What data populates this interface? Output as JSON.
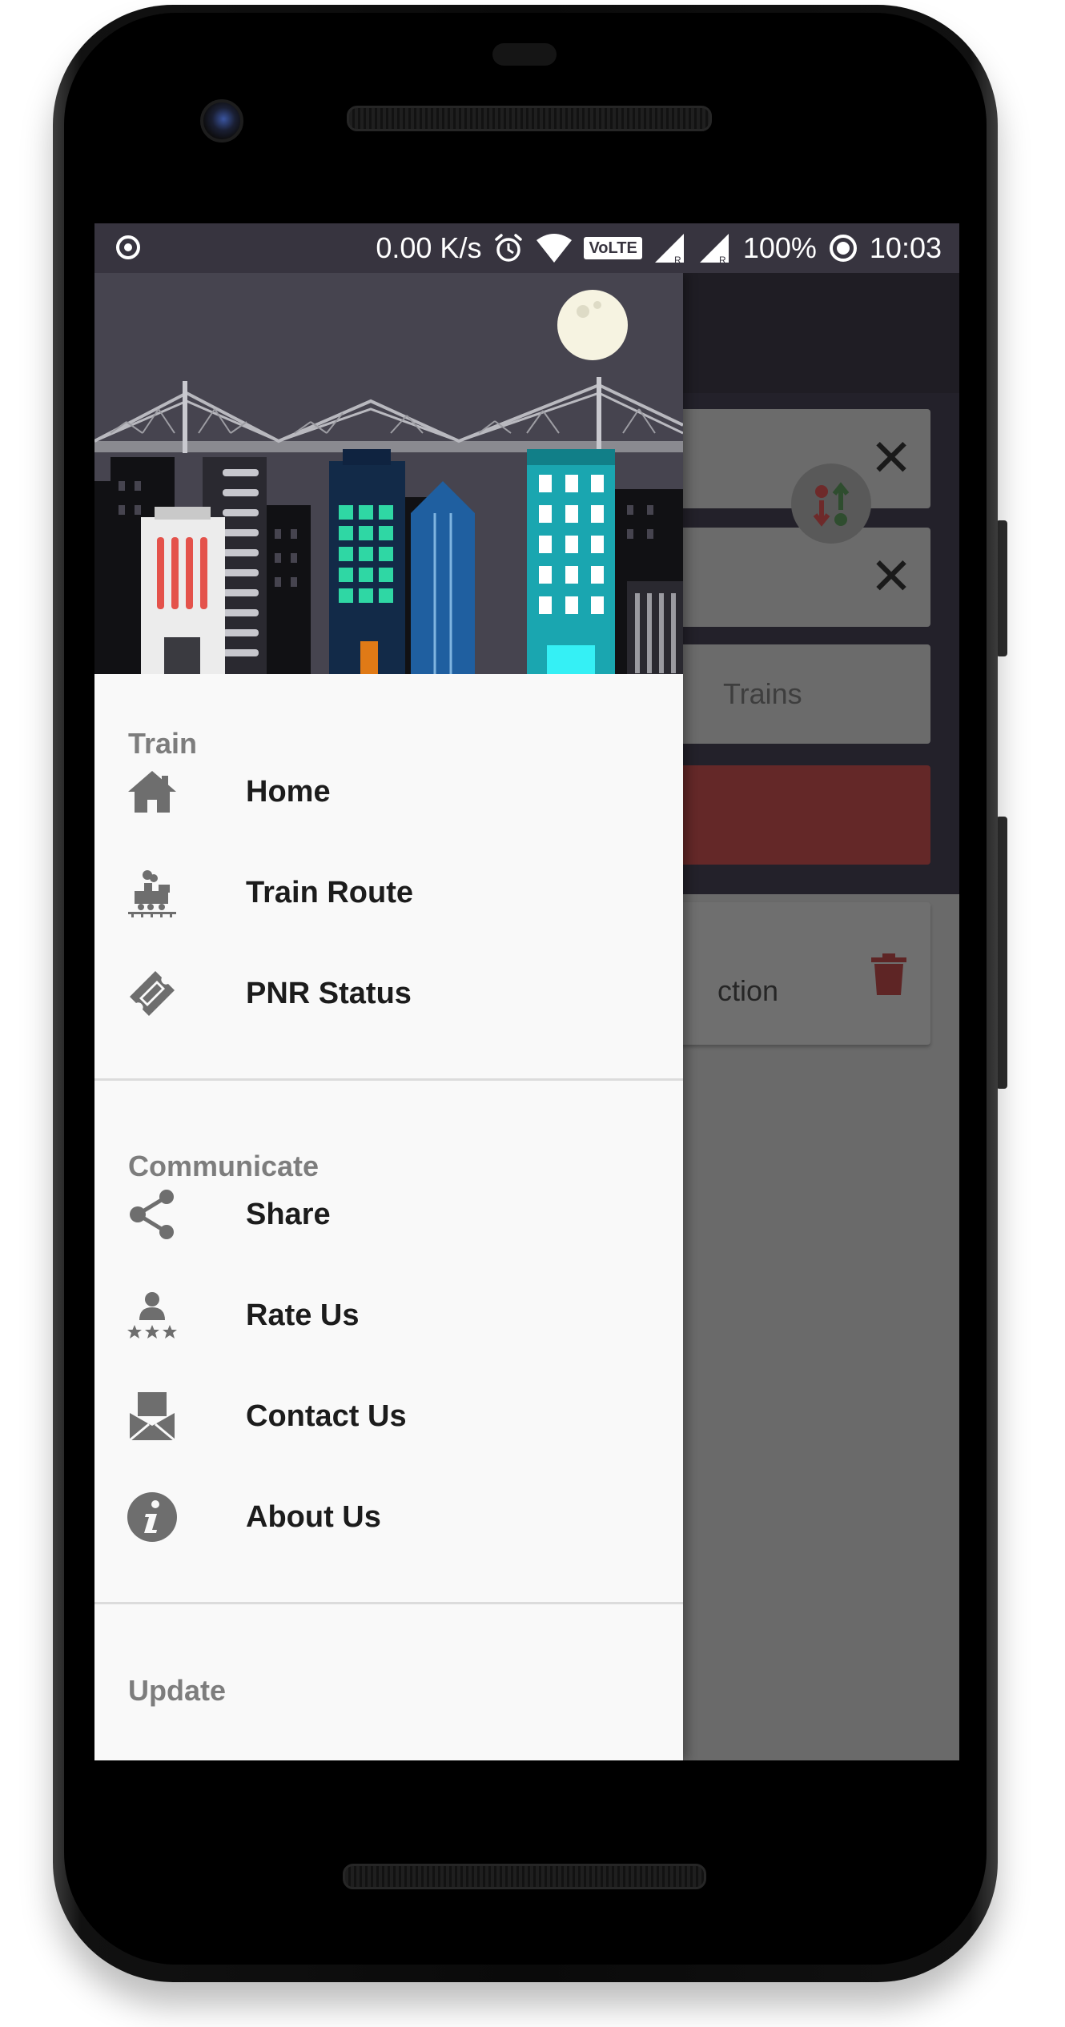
{
  "status_bar": {
    "speed": "0.00 K/s",
    "volte": "VoLTE",
    "battery": "100%",
    "time": "10:03"
  },
  "background_app": {
    "trains_text": "Trains",
    "card_text": "ction"
  },
  "drawer": {
    "sections": [
      {
        "title": "Train",
        "items": [
          {
            "label": "Home",
            "icon": "home-icon"
          },
          {
            "label": "Train Route",
            "icon": "train-icon"
          },
          {
            "label": "PNR Status",
            "icon": "ticket-icon"
          }
        ]
      },
      {
        "title": "Communicate",
        "items": [
          {
            "label": "Share",
            "icon": "share-icon"
          },
          {
            "label": "Rate Us",
            "icon": "rate-icon"
          },
          {
            "label": "Contact Us",
            "icon": "mail-icon"
          },
          {
            "label": "About Us",
            "icon": "info-icon"
          }
        ]
      },
      {
        "title": "Update",
        "items": []
      }
    ]
  },
  "colors": {
    "drawer_bg": "#f9f9f9",
    "icon_gray": "#6e6e6e",
    "section_title": "#7d7d7d",
    "status_bar": "#37343f"
  }
}
